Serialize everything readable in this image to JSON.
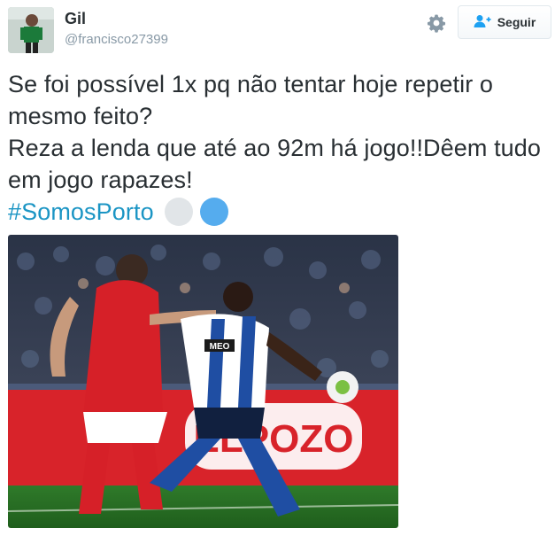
{
  "tweet": {
    "author_name": "Gil",
    "author_handle": "@francisco27399",
    "text_line1": "Se foi possível 1x pq não tentar hoje repetir o mesmo feito?",
    "text_line2": "Reza a lenda que até ao 92m há jogo!!Dêem tudo em jogo rapazes!",
    "hashtag": "#SomosPorto"
  },
  "actions": {
    "follow_label": "Seguir",
    "gear_icon": "gear-icon",
    "follow_icon": "add-user-icon"
  },
  "media": {
    "description_icon": "football-match-photo",
    "jersey_sponsor": "MEO",
    "board_text": "ELPOZO"
  },
  "colors": {
    "hashtag": "#1b95c4",
    "handle": "#8899a6",
    "follow_icon": "#1da1f2",
    "emoji_blue": "#55acee",
    "emoji_grey": "#e1e5e8"
  }
}
